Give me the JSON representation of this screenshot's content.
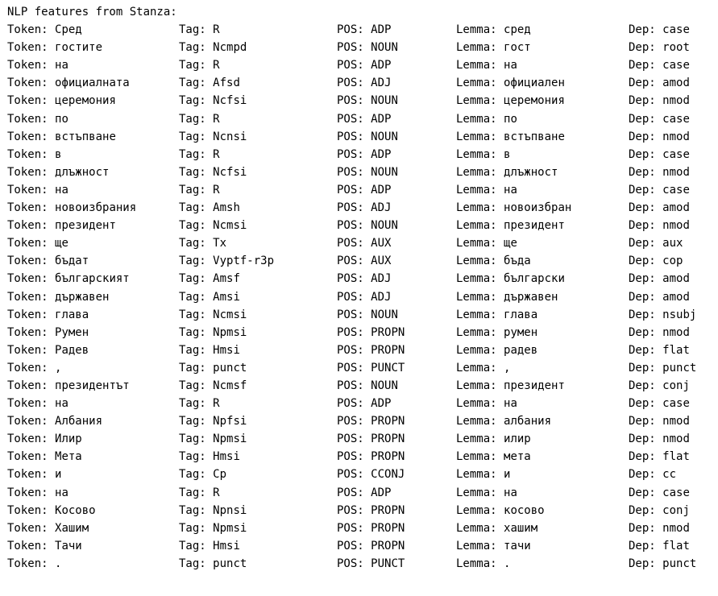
{
  "header": "NLP features from Stanza:",
  "prefixes": {
    "token": "Token: ",
    "tag": "Tag: ",
    "pos": "POS: ",
    "lemma": "Lemma: ",
    "dep": "Dep: "
  },
  "rows": [
    {
      "token": "Сред",
      "tag": "R",
      "pos": "ADP",
      "lemma": "сред",
      "dep": "case"
    },
    {
      "token": "гостите",
      "tag": "Ncmpd",
      "pos": "NOUN",
      "lemma": "гост",
      "dep": "root"
    },
    {
      "token": "на",
      "tag": "R",
      "pos": "ADP",
      "lemma": "на",
      "dep": "case"
    },
    {
      "token": "официалната",
      "tag": "Afsd",
      "pos": "ADJ",
      "lemma": "официален",
      "dep": "amod"
    },
    {
      "token": "церемония",
      "tag": "Ncfsi",
      "pos": "NOUN",
      "lemma": "церемония",
      "dep": "nmod"
    },
    {
      "token": "по",
      "tag": "R",
      "pos": "ADP",
      "lemma": "по",
      "dep": "case"
    },
    {
      "token": "встъпване",
      "tag": "Ncnsi",
      "pos": "NOUN",
      "lemma": "встъпване",
      "dep": "nmod"
    },
    {
      "token": "в",
      "tag": "R",
      "pos": "ADP",
      "lemma": "в",
      "dep": "case"
    },
    {
      "token": "длъжност",
      "tag": "Ncfsi",
      "pos": "NOUN",
      "lemma": "длъжност",
      "dep": "nmod"
    },
    {
      "token": "на",
      "tag": "R",
      "pos": "ADP",
      "lemma": "на",
      "dep": "case"
    },
    {
      "token": "новоизбрания",
      "tag": "Amsh",
      "pos": "ADJ",
      "lemma": "новоизбран",
      "dep": "amod"
    },
    {
      "token": "президент",
      "tag": "Ncmsi",
      "pos": "NOUN",
      "lemma": "президент",
      "dep": "nmod"
    },
    {
      "token": "ще",
      "tag": "Tx",
      "pos": "AUX",
      "lemma": "ще",
      "dep": "aux"
    },
    {
      "token": "бъдат",
      "tag": "Vyptf-r3p",
      "pos": "AUX",
      "lemma": "бъда",
      "dep": "cop"
    },
    {
      "token": "българският",
      "tag": "Amsf",
      "pos": "ADJ",
      "lemma": "български",
      "dep": "amod"
    },
    {
      "token": "държавен",
      "tag": "Amsi",
      "pos": "ADJ",
      "lemma": "държавен",
      "dep": "amod"
    },
    {
      "token": "глава",
      "tag": "Ncmsi",
      "pos": "NOUN",
      "lemma": "глава",
      "dep": "nsubj"
    },
    {
      "token": "Румен",
      "tag": "Npmsi",
      "pos": "PROPN",
      "lemma": "румен",
      "dep": "nmod"
    },
    {
      "token": "Радев",
      "tag": "Hmsi",
      "pos": "PROPN",
      "lemma": "радев",
      "dep": "flat"
    },
    {
      "token": ",",
      "tag": "punct",
      "pos": "PUNCT",
      "lemma": ",",
      "dep": "punct"
    },
    {
      "token": "президентът",
      "tag": "Ncmsf",
      "pos": "NOUN",
      "lemma": "президент",
      "dep": "conj"
    },
    {
      "token": "на",
      "tag": "R",
      "pos": "ADP",
      "lemma": "на",
      "dep": "case"
    },
    {
      "token": "Албания",
      "tag": "Npfsi",
      "pos": "PROPN",
      "lemma": "албания",
      "dep": "nmod"
    },
    {
      "token": "Илир",
      "tag": "Npmsi",
      "pos": "PROPN",
      "lemma": "илир",
      "dep": "nmod"
    },
    {
      "token": "Мета",
      "tag": "Hmsi",
      "pos": "PROPN",
      "lemma": "мета",
      "dep": "flat"
    },
    {
      "token": "и",
      "tag": "Cp",
      "pos": "CCONJ",
      "lemma": "и",
      "dep": "cc"
    },
    {
      "token": "на",
      "tag": "R",
      "pos": "ADP",
      "lemma": "на",
      "dep": "case"
    },
    {
      "token": "Косово",
      "tag": "Npnsi",
      "pos": "PROPN",
      "lemma": "косово",
      "dep": "conj"
    },
    {
      "token": "Хашим",
      "tag": "Npmsi",
      "pos": "PROPN",
      "lemma": "хашим",
      "dep": "nmod"
    },
    {
      "token": "Тачи",
      "tag": "Hmsi",
      "pos": "PROPN",
      "lemma": "тачи",
      "dep": "flat"
    },
    {
      "token": ".",
      "tag": "punct",
      "pos": "PUNCT",
      "lemma": ".",
      "dep": "punct"
    }
  ]
}
